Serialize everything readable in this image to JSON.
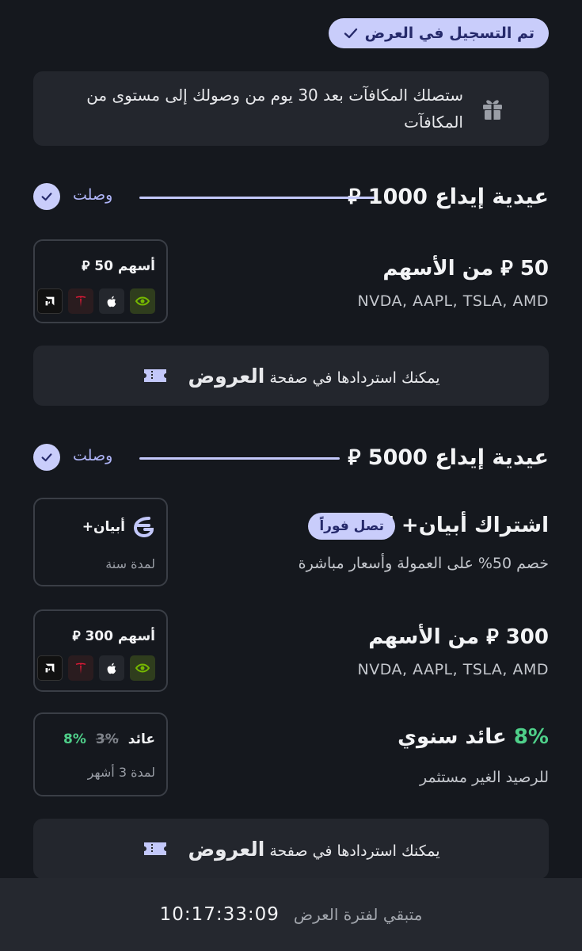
{
  "enrolled_badge": "تم التسجيل في العرض",
  "info_card": {
    "text": "ستصلك المكافآت بعد 30 يوم من وصولك إلى مستوى من المكافآت",
    "icon": "gift-icon"
  },
  "milestones": [
    {
      "title": "عيدية إيداع 1000 ⃁",
      "status": "وصلت",
      "rewards": [
        {
          "title": "50 ⃁ من الأسهم",
          "subtitle": "NVDA, AAPL, TSLA, AMD",
          "box_label": "أسهم 50 ⃁",
          "tickers": [
            "NVDA",
            "AAPL",
            "TSLA",
            "AMD"
          ]
        }
      ],
      "redeem": {
        "prefix": "يمكنك استردادها في صفحة",
        "link": "العروض"
      }
    },
    {
      "title": "عيدية إيداع 5000 ⃁",
      "status": "وصلت",
      "rewards": [
        {
          "title": "اشتراك أبيان+ لسنة",
          "badge": "تصل فوراً",
          "subtitle": "خصم 50% على العمولة وأسعار مباشرة",
          "box_label": "أبيان+",
          "box_sub": "لمدة سنة"
        },
        {
          "title": "300 ⃁ من الأسهم",
          "subtitle": "NVDA, AAPL, TSLA, AMD",
          "box_label": "أسهم 300 ⃁",
          "tickers": [
            "NVDA",
            "AAPL",
            "TSLA",
            "AMD"
          ]
        },
        {
          "title_pct": "8%",
          "title_rest": "عائد سنوي",
          "subtitle": "للرصيد الغير مستثمر",
          "box_label": "عائد",
          "box_old": "3%",
          "box_new": "8%",
          "box_sub": "لمدة 3 أشهر"
        }
      ],
      "redeem": {
        "prefix": "يمكنك استردادها في صفحة",
        "link": "العروض"
      }
    }
  ],
  "footer": {
    "label": "متبقي لفترة العرض",
    "countdown": "10:17:33:09"
  },
  "colors": {
    "background": "#15181e",
    "card": "#23262d",
    "accent": "#c9cdfb",
    "accent_text": "#262a6b",
    "green": "#4fd08a"
  }
}
